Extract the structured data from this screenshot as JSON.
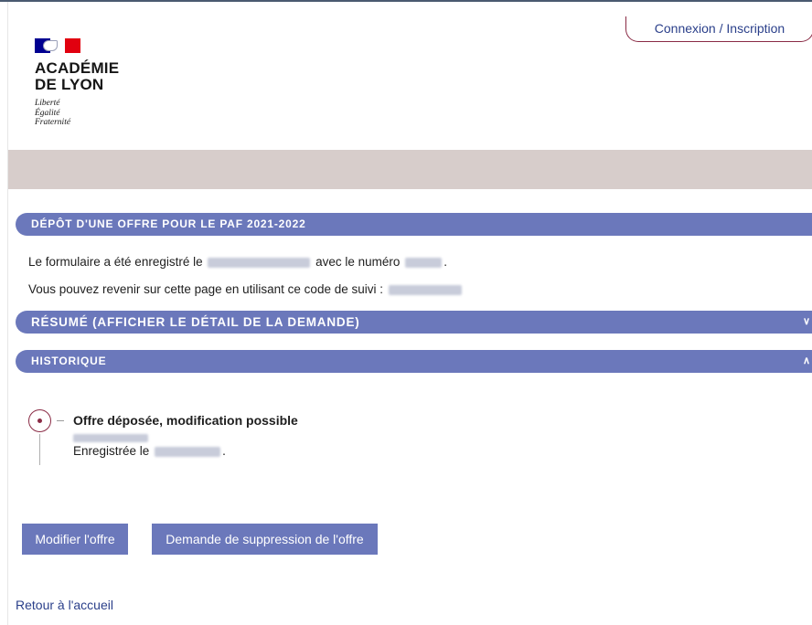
{
  "header": {
    "login_label": "Connexion / Inscription",
    "academy_line1": "ACADÉMIE",
    "academy_line2": "DE LYON",
    "motto_1": "Liberté",
    "motto_2": "Égalité",
    "motto_3": "Fraternité"
  },
  "sections": {
    "deposit": {
      "title": "DÉPÔT D'UNE OFFRE POUR LE PAF 2021-2022"
    },
    "summary": {
      "title": "RÉSUMÉ (AFFICHER LE DÉTAIL DE LA DEMANDE)"
    },
    "history": {
      "title": "HISTORIQUE"
    }
  },
  "deposit_text": {
    "saved_prefix": "Le formulaire a été enregistré le",
    "saved_middle": "avec le numéro",
    "saved_suffix": ".",
    "tracking_prefix": "Vous pouvez revenir sur cette page en utilisant ce code de suivi :"
  },
  "history_entry": {
    "title": "Offre déposée, modification possible",
    "saved_prefix": "Enregistrée le",
    "saved_suffix": "."
  },
  "actions": {
    "modify_label": "Modifier l'offre",
    "delete_label": "Demande de suppression de l'offre"
  },
  "footer": {
    "back_label": "Retour à l'accueil"
  },
  "icons": {
    "summary_toggle": "chevron-down-icon",
    "history_toggle": "chevron-up-icon"
  },
  "colors": {
    "accent": "#6b78bb",
    "brand_red": "#8a2b45",
    "link": "#2a3f8a"
  }
}
